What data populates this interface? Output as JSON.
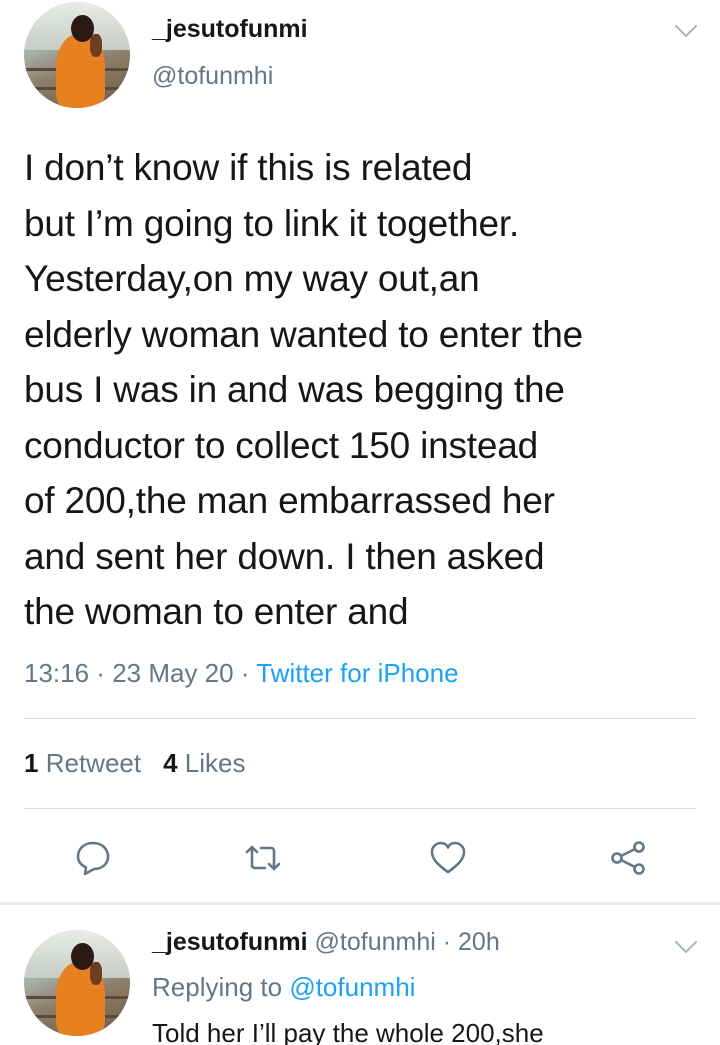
{
  "tweet": {
    "display_name": "_jesutofunmi",
    "handle": "@tofunmhi",
    "text": "I don’t know if this is related\nbut I’m going to link it together.\nYesterday,on my way out,an\nelderly woman wanted to enter the\nbus I was in and was begging the\nconductor to collect 150 instead\nof 200,the man embarrassed her\nand sent her down. I then asked\nthe woman to enter and",
    "time": "13:16",
    "date": "23 May 20",
    "source": "Twitter for iPhone",
    "separator": " · "
  },
  "stats": {
    "retweets_count": "1",
    "retweets_label": "Retweet",
    "likes_count": "4",
    "likes_label": "Likes"
  },
  "reply": {
    "display_name": "_jesutofunmi",
    "handle": "@tofunmhi",
    "age": "20h",
    "separator": " · ",
    "replying_label": "Replying to",
    "replying_handle": "@tofunmhi",
    "text": "Told her I’ll pay the whole 200,she"
  },
  "icons": {
    "reply": "reply-icon",
    "retweet": "retweet-icon",
    "like": "heart-icon",
    "share": "share-icon",
    "menu": "chevron-down-icon"
  },
  "colors": {
    "link": "#1da1f2",
    "secondary": "#657786",
    "primary_text": "#14171a",
    "divider": "#d8dfe3"
  }
}
